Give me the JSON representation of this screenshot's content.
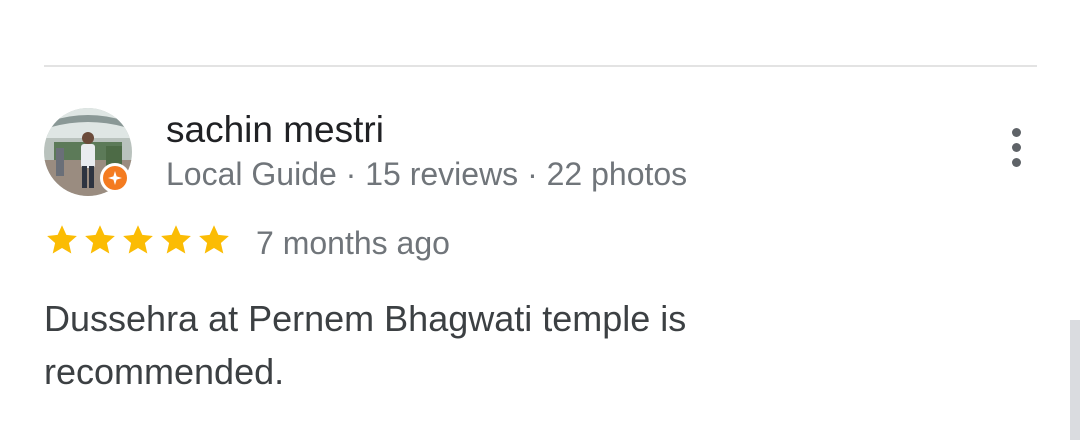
{
  "review": {
    "author_name": "sachin mestri",
    "author_meta": "Local Guide · 15 reviews · 22 photos",
    "rating": 5,
    "rating_max": 5,
    "time_ago": "7 months ago",
    "text": "Dussehra at Pernem Bhagwati temple is recommended."
  },
  "icons": {
    "avatar": "profile-photo",
    "badge": "local-guide-badge-icon",
    "more": "more-vert-icon",
    "star": "star-icon"
  },
  "colors": {
    "star": "#fbbc04",
    "badge": "#f47b20",
    "name": "#202124",
    "meta": "#70757a",
    "body_text": "#3c4043"
  }
}
